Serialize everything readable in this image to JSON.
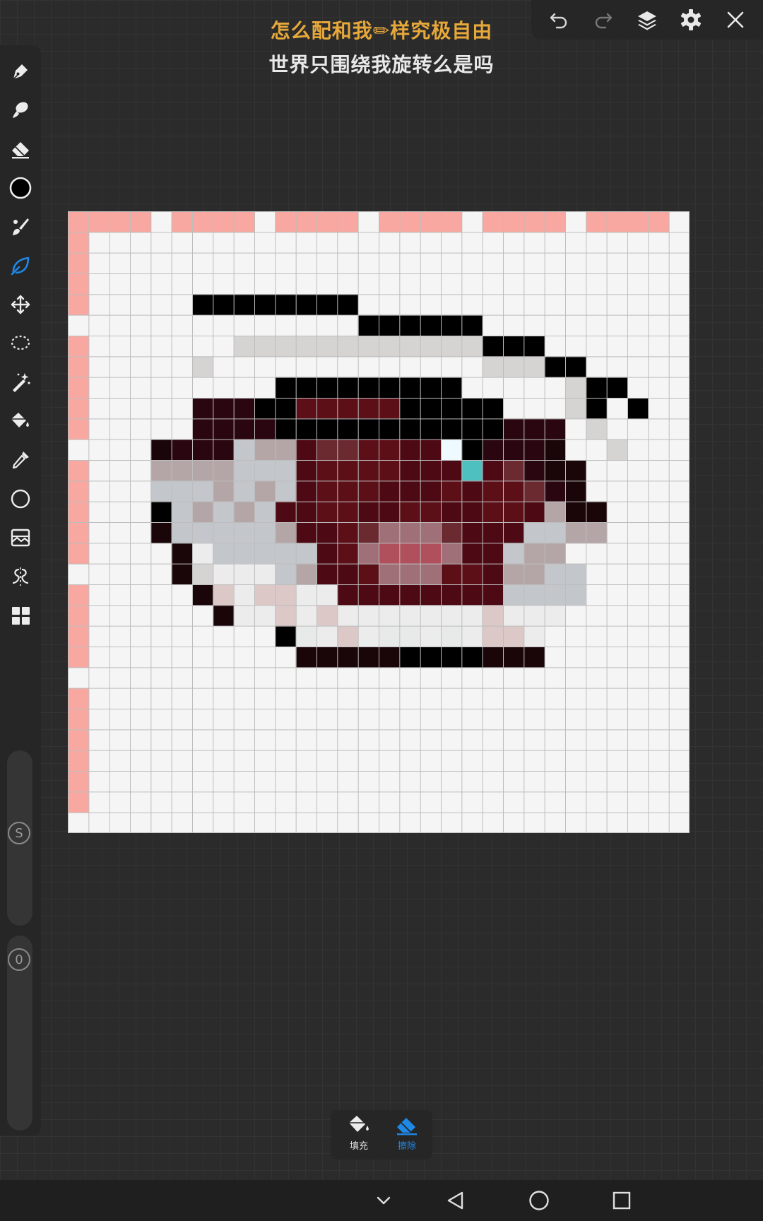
{
  "lyrics": {
    "line1": "怎么配和我✏样究极自由",
    "line2": "世界只围绕我旋转么是吗"
  },
  "top_toolbar": {
    "icons": [
      "undo-icon",
      "redo-icon",
      "layers-icon",
      "settings-gear-icon",
      "close-icon"
    ]
  },
  "left_toolbar": {
    "tools": [
      "pen-icon",
      "smudge-icon",
      "eraser-icon",
      "color-circle-icon",
      "brush-icon",
      "leaf-brush-icon",
      "move-icon",
      "lasso-icon",
      "magic-wand-icon",
      "fill-bucket-icon",
      "eyedropper-icon",
      "circle-shape-icon",
      "image-adjust-icon",
      "symmetry-icon",
      "grid-apps-icon"
    ],
    "active_tool": "leaf-brush-icon",
    "size_slider_label": "S",
    "opacity_slider_label": "0"
  },
  "popup": {
    "fill_label": "填充",
    "erase_label": "擦除"
  },
  "colors": {
    "accent": "#1e88e5",
    "pink": "#f8a8a0",
    "canvas_bg": "#f5f5f5",
    "grid_line": "#bdbdbd",
    "black": "#000000",
    "near_black": "#1a0508",
    "dark_maroon": "#2a0710",
    "maroon": "#4e0a14",
    "crimson": "#5d0f18",
    "rose": "#b0505c",
    "dusty_pink": "#a07078",
    "gray": "#c3c7cb",
    "taupe": "#b4a6a6",
    "cyan": "#4ec0c0",
    "highlight": "#eefaff",
    "light_gray": "#d6d3d3",
    "pale_pink": "#ddc8c8"
  },
  "pixel_art": {
    "cols": 30,
    "rows": 30,
    "palette": {
      "p": "#f8a8a0",
      "b": "#000000",
      "n": "#1a0508",
      "d": "#2a0710",
      "m": "#4e0a14",
      "r": "#5d0f18",
      "k": "#6a2a30",
      "o": "#b0505c",
      "u": "#a07078",
      "g": "#c3c7cb",
      "t": "#b4a6a6",
      "c": "#4ec0c0",
      "h": "#eefaff",
      "l": "#d6d3d3",
      "s": "#ddc8c8",
      "e": "#e8eaea",
      "w": "#ececec"
    },
    "rows_data": [
      "pppp.pppp.pppp.pppp.pppp.pppp.",
      "p.............................",
      "p.............................",
      "p.............................",
      "p.....bbbbbbbb................",
      "..............bbbbbb..........",
      "p.......llllllllllllbbb.......",
      "p.....l.............lllbb.....",
      "p.........bbbbbbbbb.....lbb...",
      "p.....dddbbrrrrrbbbbb...lb.b..",
      "p.....ddddbbbbbbbbbbbddd.l....",
      "....ndddgttmkkrrmmhbdddn..l...",
      "p...ttttgggmrrrrmmmcmkdnn.....",
      "p...gggtgtgmrrrmmmrmrrkdn.....",
      "p...bgtgtgmmrrmmrrmmrrmtnn....",
      "p...ngggggtmmrkuuukmmmggtt....",
      "p....nwgggggmruoooummgtt......",
      ".....nlwwwgtmmruuurrmttgg.....",
      "p.....nswsswwmmmmmmmmgggg.....",
      "p......nwwswswwwwwwwswww......",
      "p.........bewsweewewssw.......",
      "p..........nnnnnbbbbnnn.......",
      "..............................",
      "p.............................",
      "p.............................",
      "p.............................",
      "p.............................",
      "p.............................",
      "p.............................",
      ".............................."
    ]
  }
}
